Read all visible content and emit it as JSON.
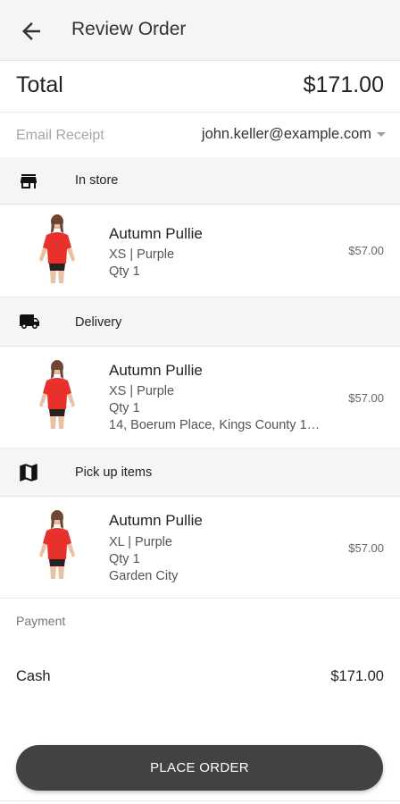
{
  "appbar": {
    "title": "Review Order",
    "back_icon": "arrow-left-icon"
  },
  "total": {
    "label": "Total",
    "value": "$171.00"
  },
  "email": {
    "label": "Email Receipt",
    "value": "john.keller@example.com"
  },
  "sections": [
    {
      "icon": "store-icon",
      "label": "In store",
      "item": {
        "name": "Autumn Pullie",
        "variant": "XS | Purple",
        "qty": "Qty 1",
        "extra": "",
        "price": "$57.00"
      }
    },
    {
      "icon": "truck-icon",
      "label": "Delivery",
      "item": {
        "name": "Autumn Pullie",
        "variant": "XS | Purple",
        "qty": "Qty 1",
        "extra": "14, Boerum Place, Kings County 1…",
        "price": "$57.00"
      }
    },
    {
      "icon": "map-icon",
      "label": "Pick up items",
      "item": {
        "name": "Autumn Pullie",
        "variant": "XL | Purple",
        "qty": "Qty 1",
        "extra": "Garden City",
        "price": "$57.00"
      }
    }
  ],
  "payment": {
    "label": "Payment",
    "method": "Cash",
    "amount": "$171.00"
  },
  "place_order": {
    "label": "PLACE ORDER"
  },
  "colors": {
    "button": "#424242",
    "header_bg": "#f5f5f5",
    "shirt": "#e8312a"
  }
}
